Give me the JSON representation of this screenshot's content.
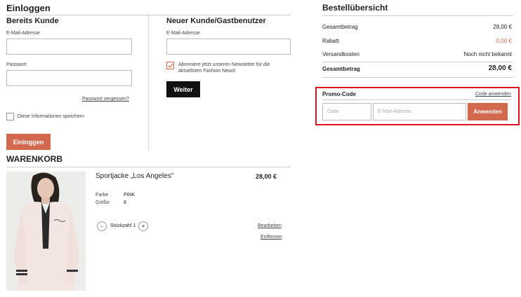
{
  "login": {
    "title": "Einloggen",
    "existing": {
      "heading": "Bereits Kunde",
      "email_label": "E-Mail-Adresse",
      "password_label": "Passwort",
      "forgot_link": "Passwort vergessen?",
      "remember_label": "Diese Informationen speichern",
      "login_button": "Einloggen"
    },
    "new": {
      "heading": "Neuer Kunde/Gastbenutzer",
      "email_label": "E-Mail-Adresse",
      "newsletter_label_1": "Abonniere jetzt unseren Newsletter für die",
      "newsletter_label_2": "aktuellsten Fashion News!",
      "continue_button": "Weiter"
    }
  },
  "cart": {
    "title": "WARENKORB",
    "item": {
      "name": "Sportjacke „Los Angeles\"",
      "price": "28,00 €",
      "color_label": "Farbe",
      "color_value": "PINK",
      "size_label": "Größe",
      "size_value": "8",
      "minus": "-",
      "quantity_label": "Stückzahl 1",
      "plus": "+",
      "edit_link": "Bearbeiten",
      "remove_link": "Entfernen"
    }
  },
  "summary": {
    "title": "Bestellübersicht",
    "rows": [
      {
        "label": "Gesamtbetrag",
        "value": "28,00 €"
      },
      {
        "label": "Rabatt",
        "value": "0,00 €"
      },
      {
        "label": "Versandkosten",
        "value": "Noch nicht bekannt"
      }
    ],
    "total_label": "Gesamtbetrag",
    "total_value": "28,00 €",
    "discount_color": "#d2694f"
  },
  "promo": {
    "title": "Promo-Code",
    "apply_link": "Code anwenden",
    "code_placeholder": "Code",
    "email_placeholder": "E-Mail-Adresse",
    "apply_button": "Anwenden",
    "highlight_color": "#e0141e"
  },
  "colors": {
    "accent": "#d2694f",
    "dark_button": "#111111"
  }
}
